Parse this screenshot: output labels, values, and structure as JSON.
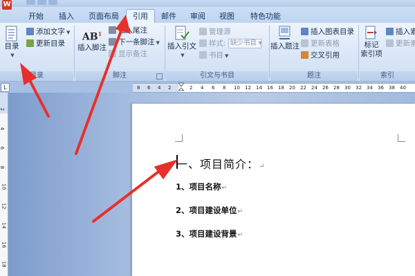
{
  "app": {
    "icon_letter": "W"
  },
  "tabs": [
    {
      "label": "开始"
    },
    {
      "label": "插入"
    },
    {
      "label": "页面布局"
    },
    {
      "label": "引用"
    },
    {
      "label": "邮件"
    },
    {
      "label": "审阅"
    },
    {
      "label": "视图"
    },
    {
      "label": "特色功能"
    }
  ],
  "active_tab": "引用",
  "ribbon": {
    "toc": {
      "label": "目录",
      "toc_button": "目录",
      "add_text": "添加文字",
      "update_toc": "更新目录"
    },
    "footnotes": {
      "label": "脚注",
      "insert_footnote": "插入脚注",
      "insert_endnote": "插入尾注",
      "next_footnote": "下一条脚注",
      "show_notes": "显示备注"
    },
    "citations": {
      "label": "引文与书目",
      "insert_citation": "插入引文",
      "manage_sources": "管理源",
      "style_label": "样式:",
      "style_value": "缺少书目",
      "bibliography": "书目"
    },
    "captions": {
      "label": "题注",
      "insert_caption": "插入题注",
      "insert_table_of_figures": "插入图表目录",
      "update_table": "更新表格",
      "cross_reference": "交叉引用"
    },
    "index": {
      "label": "索引",
      "mark_entry_line1": "标记",
      "mark_entry_line2": "索引项",
      "insert_index": "插入索",
      "update_index": "更新索"
    }
  },
  "ruler": {
    "ticks": [
      "8",
      "6",
      "4",
      "2",
      "2",
      "4",
      "6",
      "8",
      "10",
      "12",
      "14",
      "16",
      "18",
      "20",
      "22",
      "24",
      "26",
      "28",
      "30",
      "32",
      "34",
      "36",
      "38",
      "40"
    ],
    "corner": "L"
  },
  "vruler_ticks": [
    "2",
    "4",
    "6",
    "8",
    "10",
    "12",
    "14",
    "16",
    "18"
  ],
  "document": {
    "heading": "一、项目简介：",
    "items": [
      "1、项目名称",
      "2、项目建设单位",
      "3、项目建设背景"
    ],
    "para_mark": "↵"
  },
  "colors": {
    "annotation_arrow": "#e8302a",
    "ribbon_bg": "#dbe7f7",
    "workspace_bg": "#a6bde0"
  }
}
